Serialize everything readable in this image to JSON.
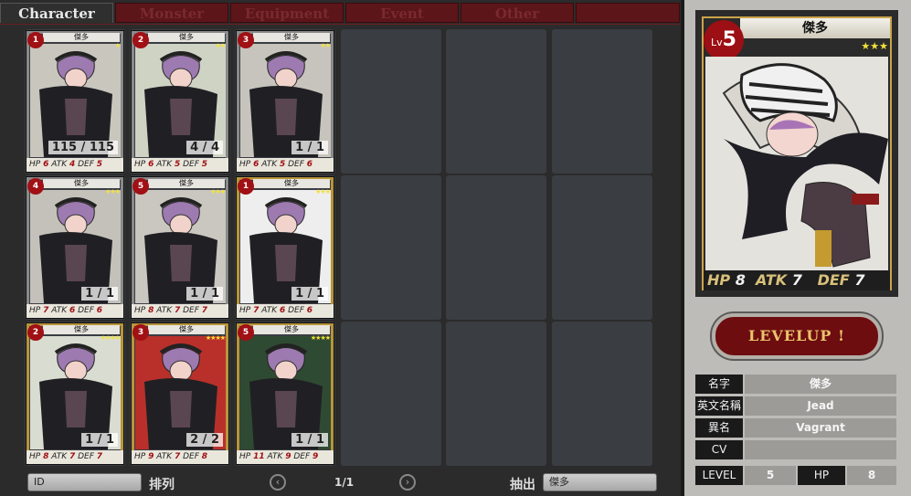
{
  "tabs": [
    "Character",
    "Monster",
    "Equipment",
    "Event",
    "Other"
  ],
  "cards": [
    {
      "name": "傑多",
      "lv": "1",
      "stars": "★",
      "count": "115 / 115",
      "hp": "6",
      "atk": "4",
      "def": "5",
      "frame": "silver"
    },
    {
      "name": "傑多",
      "lv": "2",
      "stars": "★★",
      "count": "4 / 4",
      "hp": "6",
      "atk": "5",
      "def": "5",
      "frame": "silver"
    },
    {
      "name": "傑多",
      "lv": "3",
      "stars": "★★",
      "count": "1 / 1",
      "hp": "6",
      "atk": "5",
      "def": "6",
      "frame": "silver"
    },
    {
      "name": "傑多",
      "lv": "4",
      "stars": "★★★",
      "count": "1 / 1",
      "hp": "7",
      "atk": "6",
      "def": "6",
      "frame": "silver"
    },
    {
      "name": "傑多",
      "lv": "5",
      "stars": "★★★",
      "count": "1 / 1",
      "hp": "8",
      "atk": "7",
      "def": "7",
      "frame": "silver"
    },
    {
      "name": "傑多",
      "lv": "1",
      "stars": "★★★",
      "count": "1 / 1",
      "hp": "7",
      "atk": "6",
      "def": "6",
      "frame": "gold"
    },
    {
      "name": "傑多",
      "lv": "2",
      "stars": "★★★★",
      "count": "1 / 1",
      "hp": "8",
      "atk": "7",
      "def": "7",
      "frame": "gold"
    },
    {
      "name": "傑多",
      "lv": "3",
      "stars": "★★★★",
      "count": "2 / 2",
      "hp": "9",
      "atk": "7",
      "def": "8",
      "frame": "gold"
    },
    {
      "name": "傑多",
      "lv": "5",
      "stars": "★★★★",
      "count": "1 / 1",
      "hp": "11",
      "atk": "9",
      "def": "9",
      "frame": "gold"
    }
  ],
  "bottom": {
    "id_placeholder": "ID",
    "sort_label": "排列",
    "page": "1/1",
    "extract_label": "抽出",
    "filter_value": "傑多"
  },
  "detail": {
    "name": "傑多",
    "lv_prefix": "Lv",
    "lv": "5",
    "stars": "★★★",
    "hp_label": "HP",
    "hp": "8",
    "atk_label": "ATK",
    "atk": "7",
    "def_label": "DEF",
    "def": "7",
    "levelup": "LEVELUP !",
    "info": [
      {
        "k": "名字",
        "v": "傑多"
      },
      {
        "k": "英文名稱",
        "v": "Jead"
      },
      {
        "k": "異名",
        "v": "Vagrant"
      },
      {
        "k": "CV",
        "v": ""
      }
    ],
    "level_label": "LEVEL",
    "level": "5",
    "hp2_label": "HP",
    "hp2": "8"
  },
  "colors": {
    "accent": "#a01015",
    "tab_inactive": "#5c1519",
    "gold": "#b8953a"
  }
}
